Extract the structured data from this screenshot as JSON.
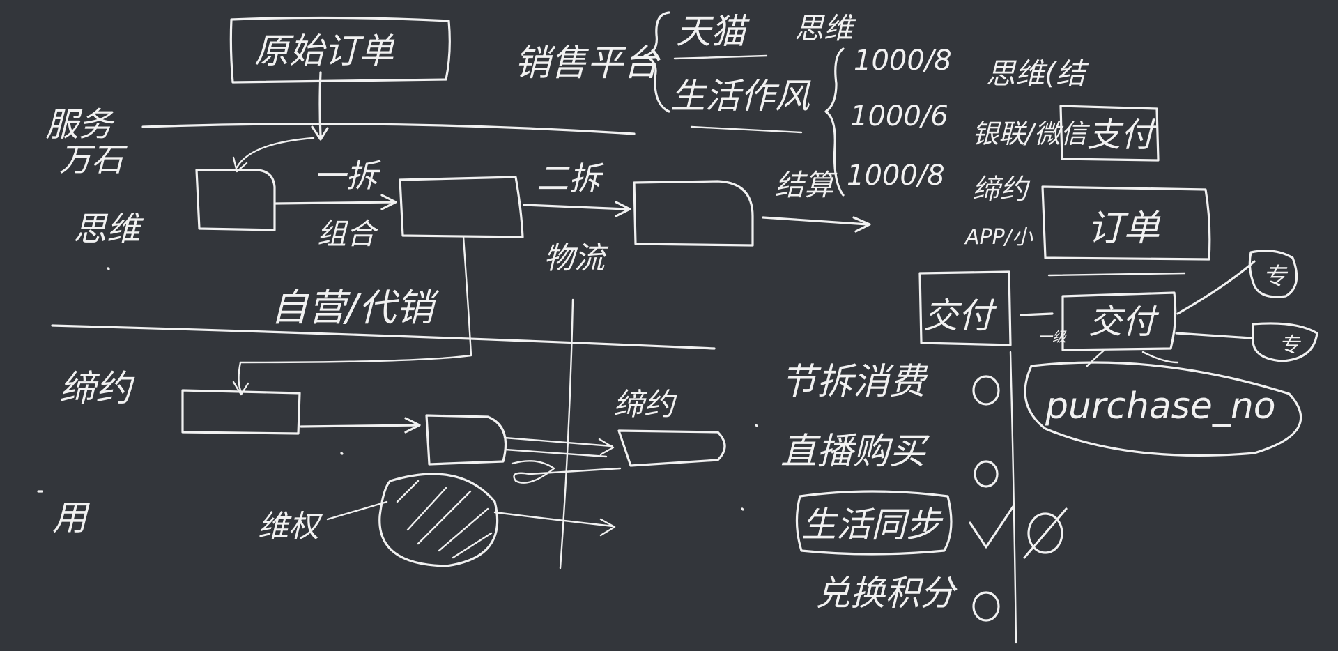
{
  "canvas": {
    "background": "#33363b",
    "ink": "#f1f1f1"
  },
  "labels": {
    "original_order": "原始订单",
    "left_top": "服务",
    "left_top2": "万石",
    "left_thinking": "思维",
    "first_split": "一拆",
    "combine": "组合",
    "self_consign": "自营/代销",
    "second_split": "二拆",
    "logistics": "物流",
    "left_mid": "缔约",
    "left_bottom": "用",
    "sales_platform": "销售平台",
    "tmall": "天猫",
    "thinking_top": "思维",
    "store_style": "生活作风",
    "amount_1": "1000/8",
    "amount_2": "1000/6",
    "amount_3": "1000/8",
    "settle_arrow": "结算",
    "thinking_pay": "思维(结",
    "union_pay": "银联/微信",
    "pay_box": "支付",
    "union_app": "缔约",
    "app_label": "APP/小",
    "order_box": "订单",
    "deliver_left": "交付",
    "deliver_box": "交付",
    "level_one": "一级",
    "right_node1": "专",
    "right_node2": "专",
    "purchase_no": "purchase_no",
    "festival": "节拆消费",
    "live_buy": "直播购买",
    "life_together": "生活同步",
    "exchange": "兑换积分",
    "bottom_left_handle": "维权",
    "bottom_right_label": "缔约"
  }
}
